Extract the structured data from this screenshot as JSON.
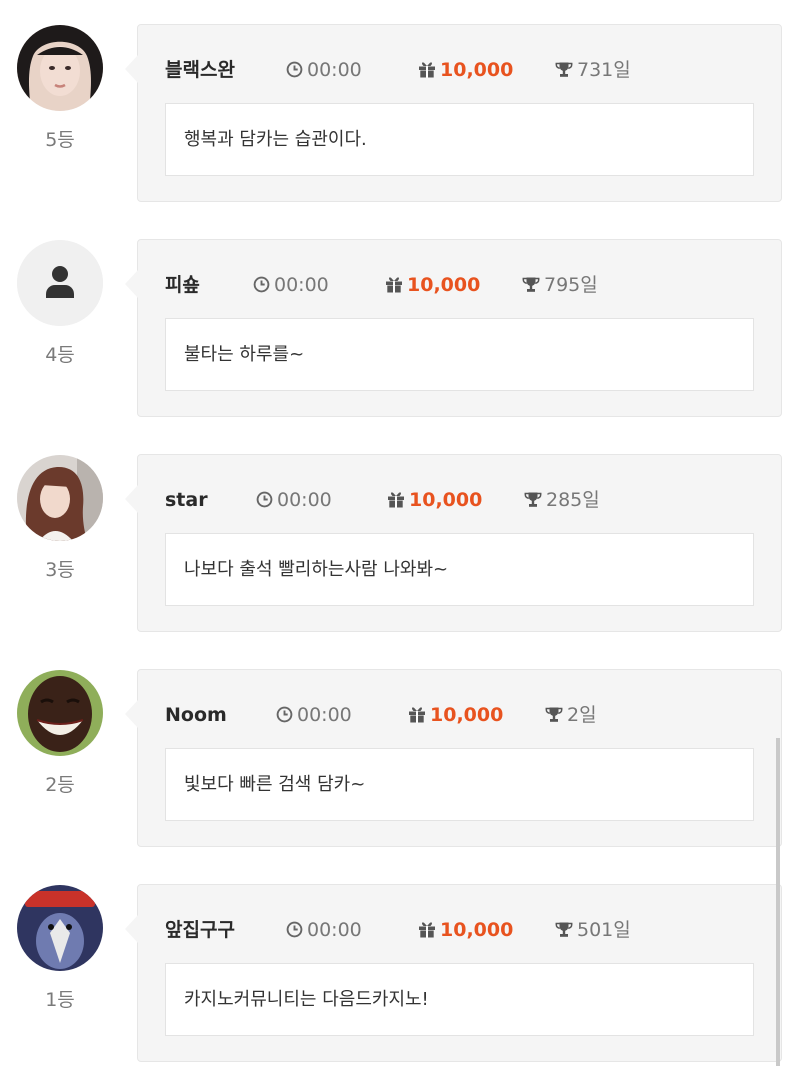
{
  "entries": [
    {
      "rank": "5등",
      "name": "블랙스완",
      "time": "00:00",
      "points": "10,000",
      "days": "731일",
      "message": "행복과 담카는 습관이다.",
      "avatar_icon": "profile-photo-woman-icon"
    },
    {
      "rank": "4등",
      "name": "피숖",
      "time": "00:00",
      "points": "10,000",
      "days": "795일",
      "message": "불타는 하루를~",
      "avatar_icon": "default-user-icon"
    },
    {
      "rank": "3등",
      "name": "star",
      "time": "00:00",
      "points": "10,000",
      "days": "285일",
      "message": "나보다 출석 빨리하는사람 나와봐~",
      "avatar_icon": "profile-photo-woman-icon"
    },
    {
      "rank": "2등",
      "name": "Noom",
      "time": "00:00",
      "points": "10,000",
      "days": "2일",
      "message": "빛보다 빠른 검색 담카~",
      "avatar_icon": "profile-photo-laughing-kid-icon"
    },
    {
      "rank": "1등",
      "name": "앞집구구",
      "time": "00:00",
      "points": "10,000",
      "days": "501일",
      "message": "카지노커뮤니티는 다음드카지노!",
      "avatar_icon": "profile-photo-penguin-icon"
    }
  ],
  "colors": {
    "points": "#e8531f",
    "card_bg": "#f5f5f5",
    "muted": "#777777"
  },
  "icons": {
    "time": "clock-icon",
    "points": "gift-icon",
    "days": "trophy-icon"
  }
}
